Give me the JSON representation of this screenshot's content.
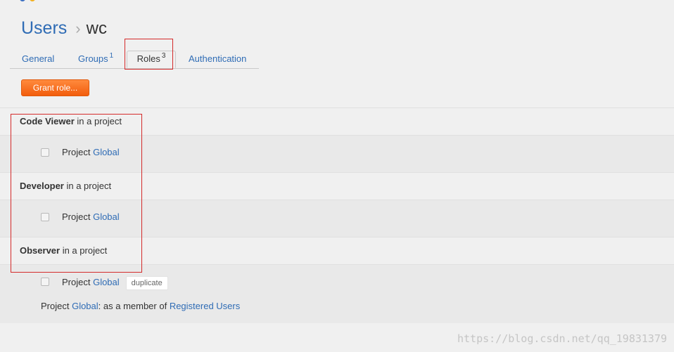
{
  "breadcrumb": {
    "users": "Users",
    "separator": "›",
    "current": "wc"
  },
  "tabs": [
    {
      "label": "General",
      "count": ""
    },
    {
      "label": "Groups",
      "count": "1"
    },
    {
      "label": "Roles",
      "count": "3"
    },
    {
      "label": "Authentication",
      "count": ""
    }
  ],
  "actions": {
    "grant_label": "Grant role..."
  },
  "roles": [
    {
      "name": "Code Viewer",
      "scope": " in a project",
      "project_prefix": "Project ",
      "project_link": "Global"
    },
    {
      "name": "Developer",
      "scope": " in a project",
      "project_prefix": "Project ",
      "project_link": "Global"
    },
    {
      "name": "Observer",
      "scope": " in a project",
      "project_prefix": "Project ",
      "project_link": "Global",
      "badge": "duplicate",
      "member": {
        "prefix": "Project ",
        "project_link": "Global",
        "middle": ": as a member of ",
        "group_link": "Registered Users"
      }
    }
  ],
  "watermark": "https://blog.csdn.net/qq_19831379",
  "colors": {
    "link": "#2f6cb5",
    "accent": "#f25d0c",
    "annotation": "#d42a2a"
  }
}
